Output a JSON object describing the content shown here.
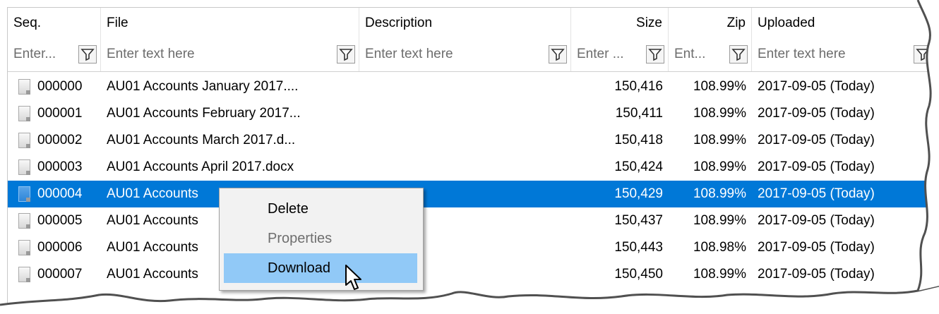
{
  "columns": [
    {
      "label": "Seq.",
      "filter": "Enter..."
    },
    {
      "label": "File",
      "filter": "Enter text here"
    },
    {
      "label": "Description",
      "filter": "Enter text here"
    },
    {
      "label": "Size",
      "filter": "Enter ..."
    },
    {
      "label": "Zip",
      "filter": "Ent..."
    },
    {
      "label": "Uploaded",
      "filter": "Enter text here"
    }
  ],
  "rows": [
    {
      "seq": "000000",
      "file": "AU01 Accounts January 2017....",
      "description": "",
      "size": "150,416",
      "zip": "108.99%",
      "uploaded": "2017-09-05 (Today)"
    },
    {
      "seq": "000001",
      "file": "AU01 Accounts February 2017...",
      "description": "",
      "size": "150,411",
      "zip": "108.99%",
      "uploaded": "2017-09-05 (Today)"
    },
    {
      "seq": "000002",
      "file": "AU01 Accounts March 2017.d...",
      "description": "",
      "size": "150,418",
      "zip": "108.99%",
      "uploaded": "2017-09-05 (Today)"
    },
    {
      "seq": "000003",
      "file": "AU01 Accounts April 2017.docx",
      "description": "",
      "size": "150,424",
      "zip": "108.99%",
      "uploaded": "2017-09-05 (Today)"
    },
    {
      "seq": "000004",
      "file": "AU01 Accounts",
      "description": "",
      "size": "150,429",
      "zip": "108.99%",
      "uploaded": "2017-09-05 (Today)"
    },
    {
      "seq": "000005",
      "file": "AU01 Accounts",
      "description": "",
      "size": "150,437",
      "zip": "108.99%",
      "uploaded": "2017-09-05 (Today)"
    },
    {
      "seq": "000006",
      "file": "AU01 Accounts",
      "description": "",
      "size": "150,443",
      "zip": "108.98%",
      "uploaded": "2017-09-05 (Today)"
    },
    {
      "seq": "000007",
      "file": "AU01 Accounts",
      "description": "",
      "size": "150,450",
      "zip": "108.99%",
      "uploaded": "2017-09-05 (Today)"
    }
  ],
  "selected_row_index": 4,
  "context_menu": {
    "items": [
      {
        "label": "Delete",
        "enabled": true
      },
      {
        "label": "Properties",
        "enabled": false
      },
      {
        "label": "Download",
        "enabled": true
      }
    ],
    "hovered_item": "Download"
  },
  "colors": {
    "selection": "#0078d7",
    "menu_hover": "#91c9f7",
    "menu_background": "#f2f2f2"
  }
}
